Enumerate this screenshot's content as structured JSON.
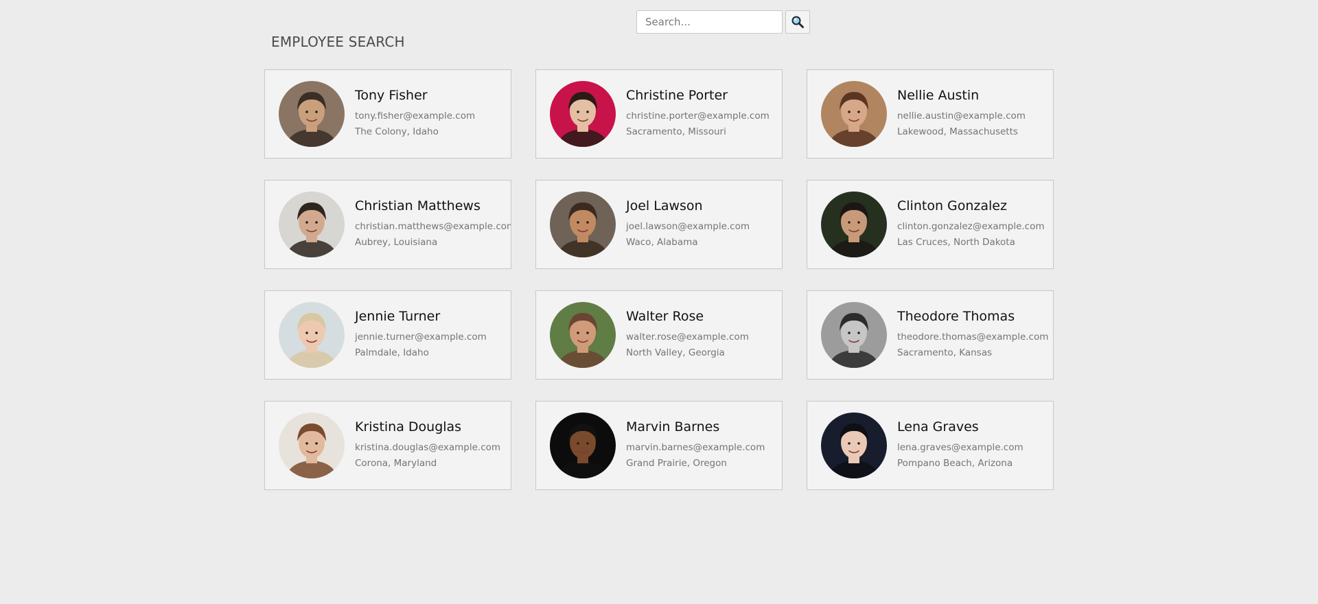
{
  "search": {
    "placeholder": "Search...",
    "value": ""
  },
  "header": {
    "title": "EMPLOYEE SEARCH"
  },
  "employees": [
    {
      "name": "Tony Fisher",
      "email": "tony.fisher@example.com",
      "location": "The Colony, Idaho",
      "avatar_bg": "#8a7565",
      "skin": "#caa07c",
      "hair": "#3a2e25"
    },
    {
      "name": "Christine Porter",
      "email": "christine.porter@example.com",
      "location": "Sacramento, Missouri",
      "avatar_bg": "#c8134a",
      "skin": "#e4bfa3",
      "hair": "#2a1b16"
    },
    {
      "name": "Nellie Austin",
      "email": "nellie.austin@example.com",
      "location": "Lakewood, Massachusetts",
      "avatar_bg": "#b18560",
      "skin": "#d6a789",
      "hair": "#5a3522"
    },
    {
      "name": "Christian Matthews",
      "email": "christian.matthews@example.com",
      "location": "Aubrey, Louisiana",
      "avatar_bg": "#d8d6d2",
      "skin": "#d2a98f",
      "hair": "#2e2621"
    },
    {
      "name": "Joel Lawson",
      "email": "joel.lawson@example.com",
      "location": "Waco, Alabama",
      "avatar_bg": "#6e6356",
      "skin": "#c28a63",
      "hair": "#3b2a1f"
    },
    {
      "name": "Clinton Gonzalez",
      "email": "clinton.gonzalez@example.com",
      "location": "Las Cruces, North Dakota",
      "avatar_bg": "#26301f",
      "skin": "#c99a7a",
      "hair": "#1b1714"
    },
    {
      "name": "Jennie Turner",
      "email": "jennie.turner@example.com",
      "location": "Palmdale, Idaho",
      "avatar_bg": "#d5dde0",
      "skin": "#ecc9b0",
      "hair": "#d9c7a2"
    },
    {
      "name": "Walter Rose",
      "email": "walter.rose@example.com",
      "location": "North Valley, Georgia",
      "avatar_bg": "#5f7d45",
      "skin": "#d19b7a",
      "hair": "#6b4532"
    },
    {
      "name": "Theodore Thomas",
      "email": "theodore.thomas@example.com",
      "location": "Sacramento, Kansas",
      "avatar_bg": "#9c9c9c",
      "skin": "#c6c6c6",
      "hair": "#2c2c2c"
    },
    {
      "name": "Kristina Douglas",
      "email": "kristina.douglas@example.com",
      "location": "Corona, Maryland",
      "avatar_bg": "#e8e2dc",
      "skin": "#e2b99c",
      "hair": "#7a4b2d"
    },
    {
      "name": "Marvin Barnes",
      "email": "marvin.barnes@example.com",
      "location": "Grand Prairie, Oregon",
      "avatar_bg": "#0c0c0c",
      "skin": "#7a4a2c",
      "hair": "#111111"
    },
    {
      "name": "Lena Graves",
      "email": "lena.graves@example.com",
      "location": "Pompano Beach, Arizona",
      "avatar_bg": "#181d2e",
      "skin": "#eac9b6",
      "hair": "#0f0f14"
    }
  ],
  "icons": {
    "search_button": "magnifier-icon"
  }
}
